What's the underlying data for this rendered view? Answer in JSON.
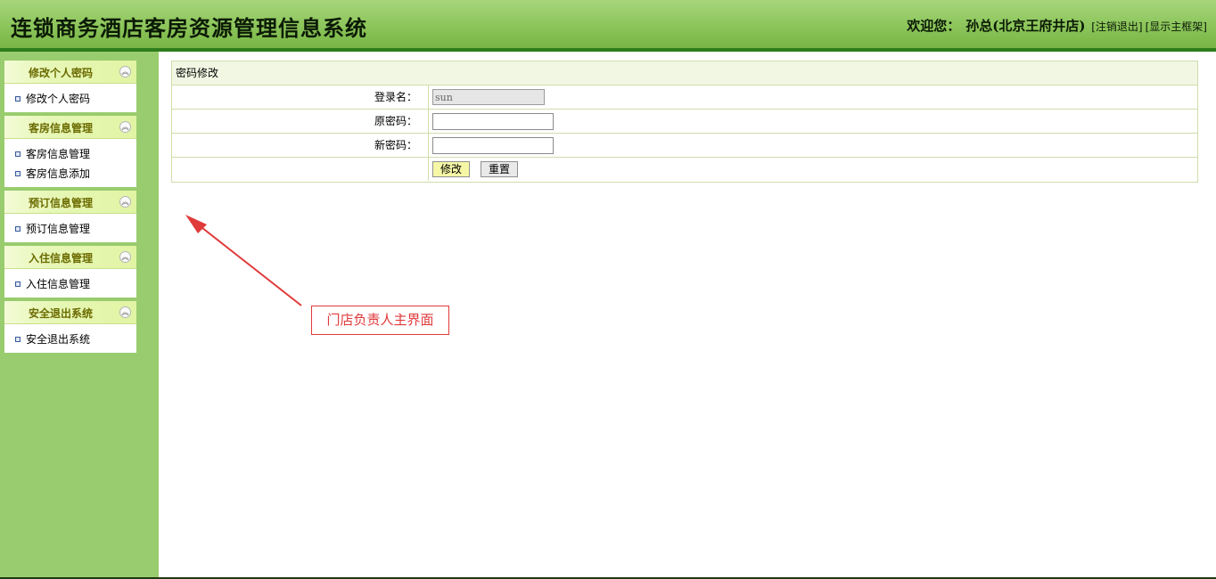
{
  "header": {
    "title": "连锁商务酒店客房资源管理信息系统",
    "welcome": "欢迎您：",
    "user": "孙总(北京王府井店)",
    "logout": "[注销退出]",
    "show_frame": "[显示主框架]"
  },
  "sidebar": {
    "panels": [
      {
        "title": "修改个人密码",
        "items": [
          "修改个人密码"
        ]
      },
      {
        "title": "客房信息管理",
        "items": [
          "客房信息管理",
          "客房信息添加"
        ]
      },
      {
        "title": "预订信息管理",
        "items": [
          "预订信息管理"
        ]
      },
      {
        "title": "入住信息管理",
        "items": [
          "入住信息管理"
        ]
      },
      {
        "title": "安全退出系统",
        "items": [
          "安全退出系统"
        ]
      }
    ],
    "collapse_icon": "chevron-double-up-icon"
  },
  "form": {
    "heading": "密码修改",
    "login_label": "登录名：",
    "login_value": "sun",
    "old_pw_label": "原密码：",
    "old_pw_value": "",
    "new_pw_label": "新密码：",
    "new_pw_value": "",
    "submit_label": "修改",
    "reset_label": "重置"
  },
  "annotation": {
    "text": "门店负责人主界面",
    "color": "#e03a3a"
  },
  "colors": {
    "header_green": "#8cc55b",
    "sidebar_green": "#99cc6e",
    "panel_title": "#6b6b00"
  }
}
